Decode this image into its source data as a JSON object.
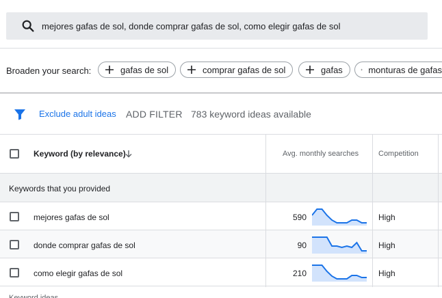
{
  "search": {
    "query": "mejores gafas de sol, donde comprar gafas de sol, como elegir gafas de sol",
    "icon": "search-icon"
  },
  "broaden": {
    "label": "Broaden your search:",
    "chips": [
      {
        "label": "gafas de sol"
      },
      {
        "label": "comprar gafas de sol"
      },
      {
        "label": "gafas"
      },
      {
        "label": "monturas de gafas"
      }
    ]
  },
  "filter_bar": {
    "exclude_label": "Exclude adult ideas",
    "add_filter_label": "ADD FILTER",
    "ideas_count": "783 keyword ideas available"
  },
  "table": {
    "headers": {
      "keyword": "Keyword (by relevance)",
      "avg_searches": "Avg. monthly searches",
      "competition": "Competition"
    },
    "group_label": "Keywords that you provided",
    "rows": [
      {
        "keyword": "mejores gafas de sol",
        "avg": "590",
        "competition": "High",
        "trend": [
          0.55,
          1.0,
          1.0,
          0.55,
          0.2,
          0.0,
          0.0,
          0.0,
          0.2,
          0.2,
          0.0,
          0.0
        ]
      },
      {
        "keyword": "donde comprar gafas de sol",
        "avg": "90",
        "competition": "High",
        "trend": [
          1.0,
          1.0,
          1.0,
          1.0,
          0.35,
          0.35,
          0.25,
          0.35,
          0.25,
          0.6,
          0.0,
          0.0
        ]
      },
      {
        "keyword": "como elegir gafas de sol",
        "avg": "210",
        "competition": "High",
        "trend": [
          1.0,
          1.0,
          1.0,
          0.55,
          0.2,
          0.0,
          0.0,
          0.0,
          0.25,
          0.25,
          0.1,
          0.1
        ]
      }
    ]
  },
  "bottom_hint": "Keyword ideas",
  "colors": {
    "accent": "#1a73e8",
    "spark_fill": "#d2e3fc",
    "group_bg": "#f1f3f4"
  }
}
